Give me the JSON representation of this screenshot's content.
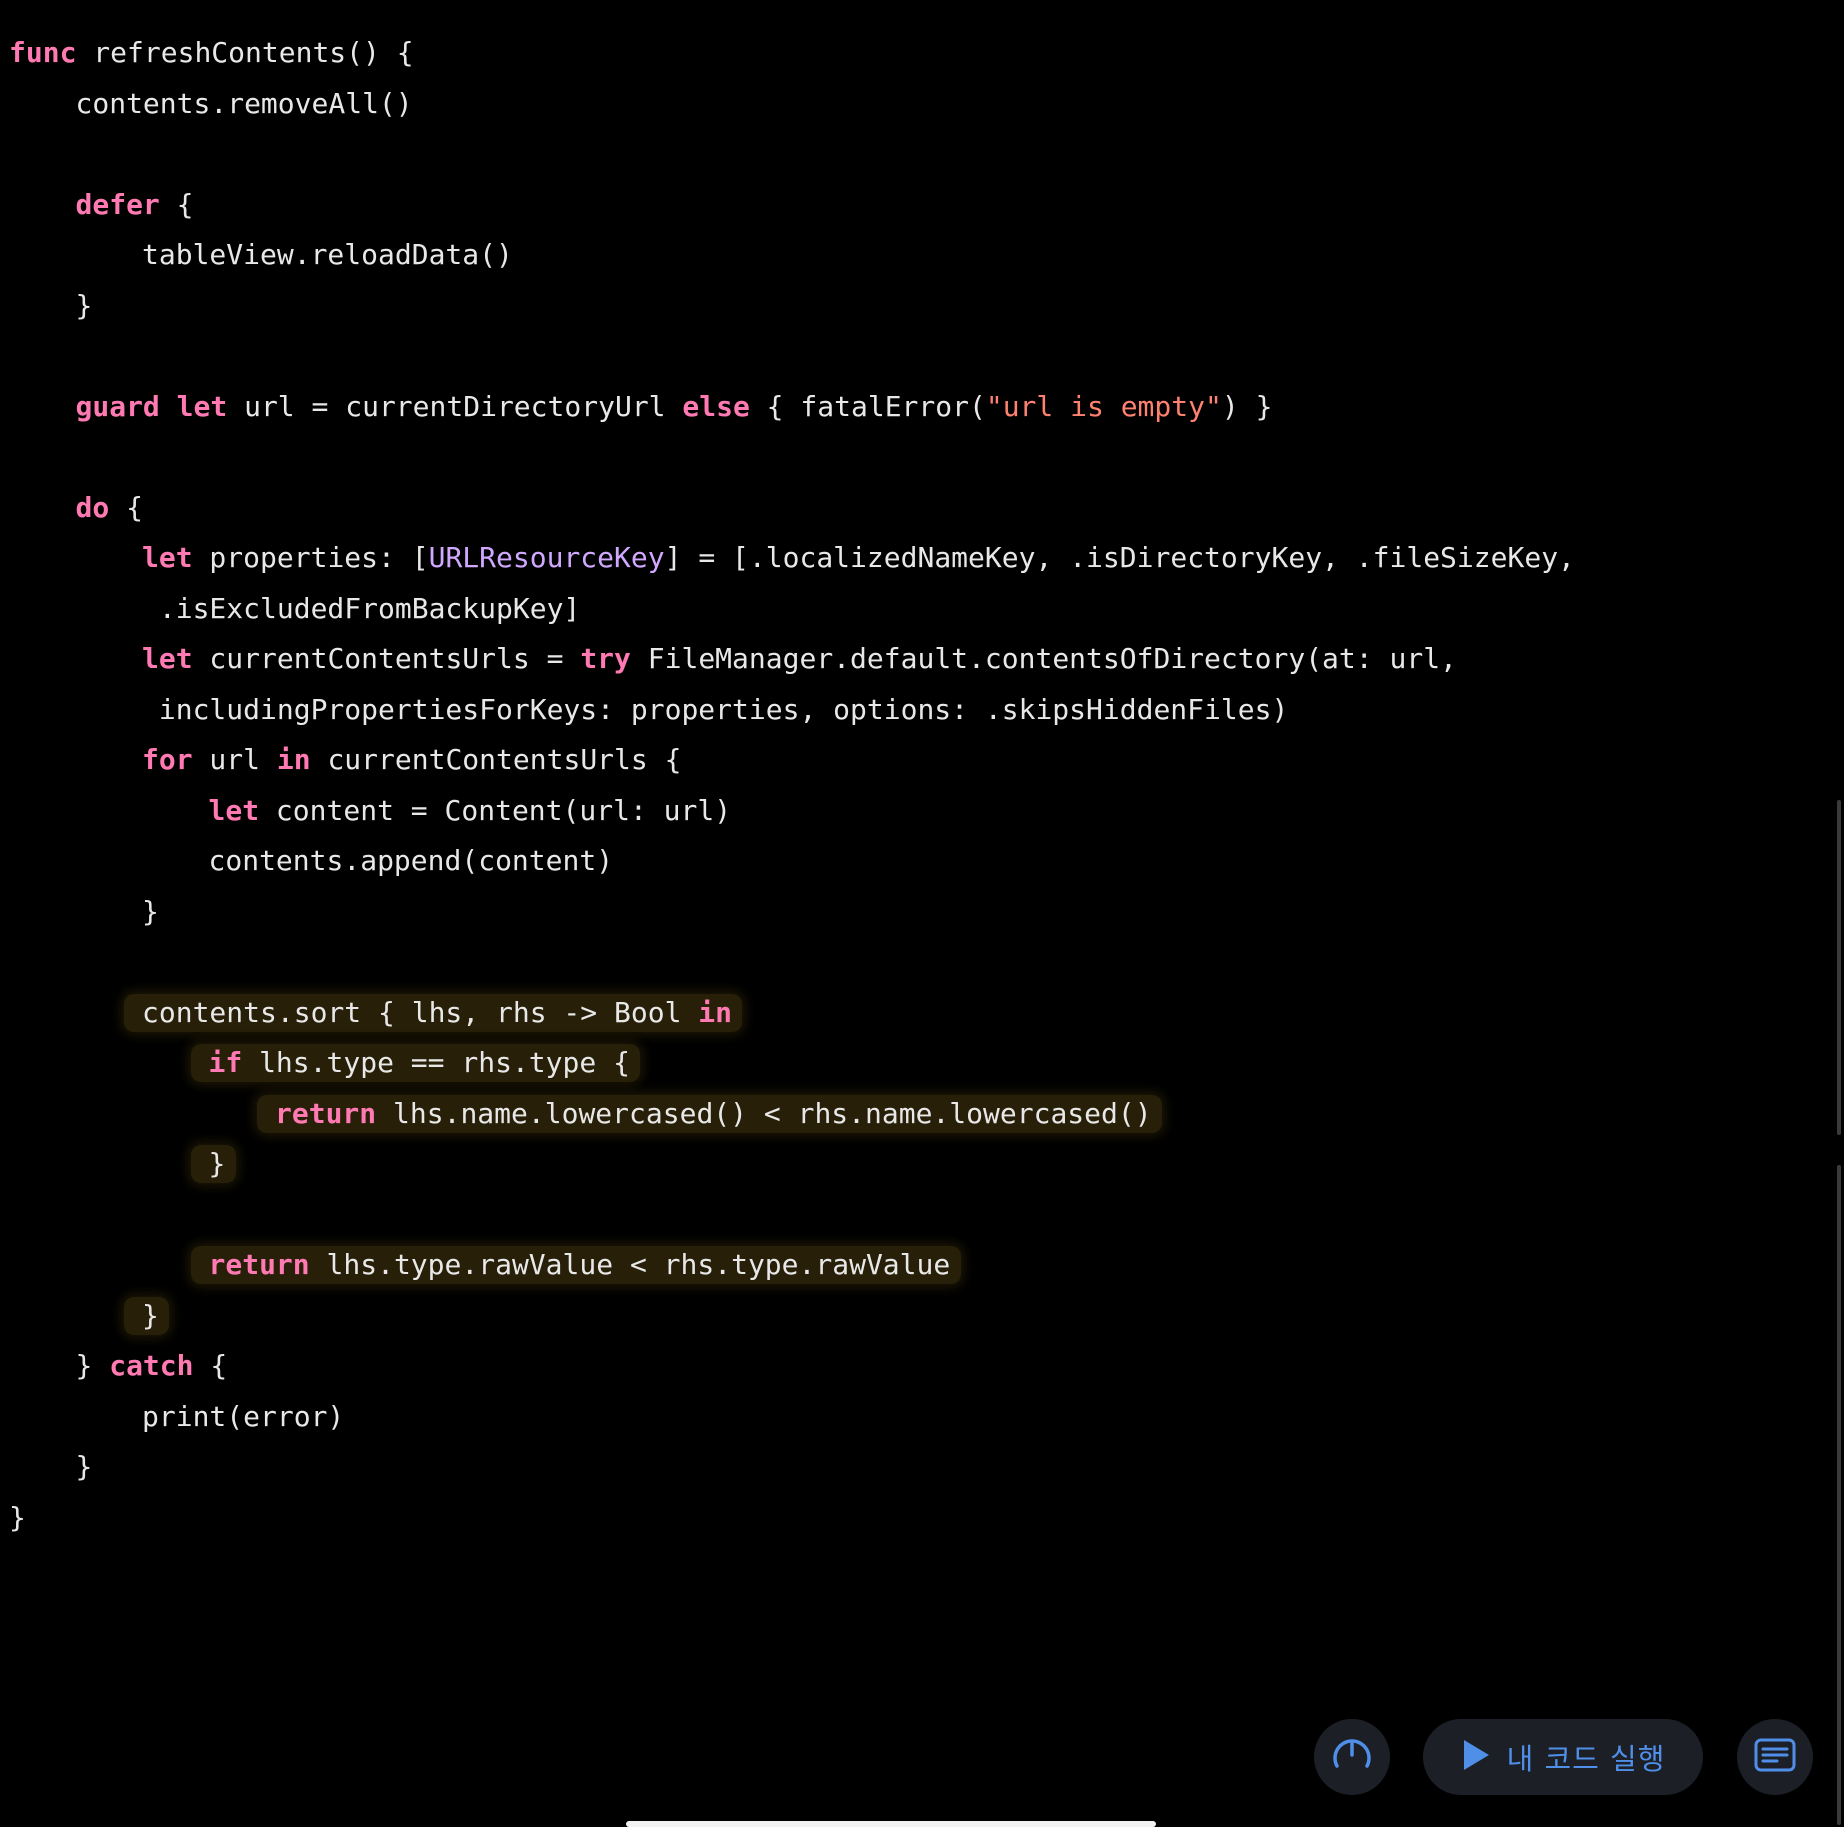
{
  "code": {
    "lines": [
      {
        "indent": 0,
        "tokens": [
          {
            "t": "func",
            "k": "keyword"
          },
          {
            "t": " refreshContents() {",
            "k": "plain"
          }
        ]
      },
      {
        "indent": 1,
        "tokens": [
          {
            "t": "contents.removeAll()",
            "k": "plain"
          }
        ]
      },
      {
        "indent": 0,
        "tokens": []
      },
      {
        "indent": 1,
        "tokens": [
          {
            "t": "defer",
            "k": "keyword"
          },
          {
            "t": " {",
            "k": "plain"
          }
        ]
      },
      {
        "indent": 2,
        "tokens": [
          {
            "t": "tableView.reloadData()",
            "k": "plain"
          }
        ]
      },
      {
        "indent": 1,
        "tokens": [
          {
            "t": "}",
            "k": "plain"
          }
        ]
      },
      {
        "indent": 0,
        "tokens": []
      },
      {
        "indent": 1,
        "tokens": [
          {
            "t": "guard",
            "k": "keyword"
          },
          {
            "t": " ",
            "k": "plain"
          },
          {
            "t": "let",
            "k": "keyword"
          },
          {
            "t": " url = currentDirectoryUrl ",
            "k": "plain"
          },
          {
            "t": "else",
            "k": "keyword"
          },
          {
            "t": " { fatalError(",
            "k": "plain"
          },
          {
            "t": "\"url is empty\"",
            "k": "string"
          },
          {
            "t": ") }",
            "k": "plain"
          }
        ]
      },
      {
        "indent": 0,
        "tokens": []
      },
      {
        "indent": 1,
        "tokens": [
          {
            "t": "do",
            "k": "keyword"
          },
          {
            "t": " {",
            "k": "plain"
          }
        ]
      },
      {
        "indent": 2,
        "tokens": [
          {
            "t": "let",
            "k": "keyword"
          },
          {
            "t": " properties: [",
            "k": "plain"
          },
          {
            "t": "URLResourceKey",
            "k": "type"
          },
          {
            "t": "] = [.localizedNameKey, .isDirectoryKey, .fileSizeKey,",
            "k": "plain"
          }
        ]
      },
      {
        "indent": 2,
        "tokens": [
          {
            "t": " .isExcludedFromBackupKey]",
            "k": "plain"
          }
        ]
      },
      {
        "indent": 2,
        "tokens": [
          {
            "t": "let",
            "k": "keyword"
          },
          {
            "t": " currentContentsUrls = ",
            "k": "plain"
          },
          {
            "t": "try",
            "k": "keyword"
          },
          {
            "t": " FileManager.default.contentsOfDirectory(at: url,",
            "k": "plain"
          }
        ]
      },
      {
        "indent": 2,
        "tokens": [
          {
            "t": " includingPropertiesForKeys: properties, options: .skipsHiddenFiles)",
            "k": "plain"
          }
        ]
      },
      {
        "indent": 2,
        "tokens": [
          {
            "t": "for",
            "k": "keyword"
          },
          {
            "t": " url ",
            "k": "plain"
          },
          {
            "t": "in",
            "k": "keyword"
          },
          {
            "t": " currentContentsUrls {",
            "k": "plain"
          }
        ]
      },
      {
        "indent": 3,
        "tokens": [
          {
            "t": "let",
            "k": "keyword"
          },
          {
            "t": " content = Content(url: url)",
            "k": "plain"
          }
        ]
      },
      {
        "indent": 3,
        "tokens": [
          {
            "t": "contents.append(content)",
            "k": "plain"
          }
        ]
      },
      {
        "indent": 2,
        "tokens": [
          {
            "t": "}",
            "k": "plain"
          }
        ]
      },
      {
        "indent": 0,
        "tokens": []
      },
      {
        "indent": 2,
        "highlight": true,
        "tokens": [
          {
            "t": "contents.sort { lhs, rhs -> Bool ",
            "k": "plain"
          },
          {
            "t": "in",
            "k": "keyword"
          }
        ]
      },
      {
        "indent": 3,
        "highlight": true,
        "tokens": [
          {
            "t": "if",
            "k": "keyword"
          },
          {
            "t": " lhs.type == rhs.type {",
            "k": "plain"
          }
        ]
      },
      {
        "indent": 4,
        "highlight": true,
        "tokens": [
          {
            "t": "return",
            "k": "keyword"
          },
          {
            "t": " lhs.name.lowercased() < rhs.name.lowercased()",
            "k": "plain"
          }
        ]
      },
      {
        "indent": 3,
        "highlight": true,
        "tokens": [
          {
            "t": "}",
            "k": "plain"
          }
        ]
      },
      {
        "indent": 0,
        "tokens": []
      },
      {
        "indent": 3,
        "highlight": true,
        "tokens": [
          {
            "t": "return",
            "k": "keyword"
          },
          {
            "t": " lhs.type.rawValue < rhs.type.rawValue",
            "k": "plain"
          }
        ]
      },
      {
        "indent": 2,
        "highlight": true,
        "tokens": [
          {
            "t": "}",
            "k": "plain"
          }
        ]
      },
      {
        "indent": 1,
        "tokens": [
          {
            "t": "} ",
            "k": "plain"
          },
          {
            "t": "catch",
            "k": "keyword"
          },
          {
            "t": " {",
            "k": "plain"
          }
        ]
      },
      {
        "indent": 2,
        "tokens": [
          {
            "t": "print(error)",
            "k": "plain"
          }
        ]
      },
      {
        "indent": 1,
        "tokens": [
          {
            "t": "}",
            "k": "plain"
          }
        ]
      },
      {
        "indent": 0,
        "tokens": [
          {
            "t": "}",
            "k": "plain"
          }
        ]
      }
    ]
  },
  "toolbar": {
    "speed_icon": "speedometer-icon",
    "run_icon": "play-icon",
    "run_label": "내 코드 실행",
    "panel_icon": "text-panel-icon"
  },
  "colors": {
    "background": "#000000",
    "keyword": "#ff7ab2",
    "plain": "#e8e8e8",
    "string": "#ff8170",
    "type": "#d0a8ff",
    "accent": "#4f8fe8",
    "highlight": "rgba(120, 95, 25, 0.32)"
  }
}
